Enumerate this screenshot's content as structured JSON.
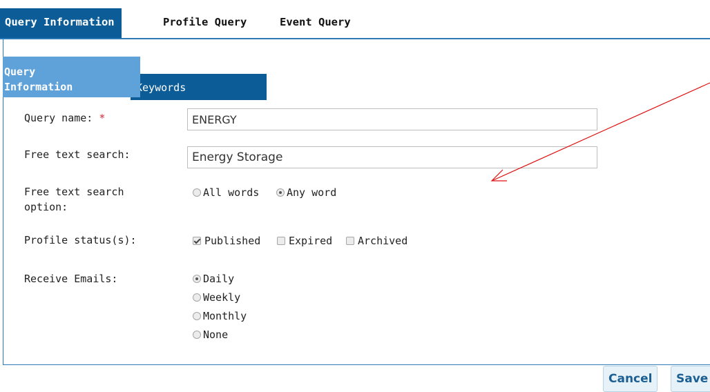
{
  "top_tabs": [
    {
      "label": "Query Information",
      "active": true
    },
    {
      "label": "Profile Query",
      "active": false
    },
    {
      "label": "Event Query",
      "active": false
    }
  ],
  "sub_tabs": [
    {
      "label": "Query Information",
      "active": true
    },
    {
      "label": "Keywords",
      "active": false
    }
  ],
  "form": {
    "query_name": {
      "label": "Query name:",
      "required_mark": "*",
      "value": "ENERGY"
    },
    "free_text": {
      "label": "Free text search:",
      "value": "Energy Storage"
    },
    "free_text_option": {
      "label": "Free text search option:",
      "options": [
        {
          "label": "All words",
          "selected": false
        },
        {
          "label": "Any word",
          "selected": true
        }
      ]
    },
    "profile_status": {
      "label": "Profile status(s):",
      "options": [
        {
          "label": "Published",
          "checked": true
        },
        {
          "label": "Expired",
          "checked": false
        },
        {
          "label": "Archived",
          "checked": false
        }
      ]
    },
    "receive_emails": {
      "label": "Receive Emails:",
      "options": [
        {
          "label": "Daily",
          "selected": true
        },
        {
          "label": "Weekly",
          "selected": false
        },
        {
          "label": "Monthly",
          "selected": false
        },
        {
          "label": "None",
          "selected": false
        }
      ]
    }
  },
  "buttons": {
    "cancel": "Cancel",
    "save": "Save"
  },
  "colors": {
    "tab_active": "#0b5c97",
    "subtab_active": "#5fa1d9",
    "border": "#2b79b6",
    "required": "#d9232e",
    "annotation_arrow": "#e01010"
  }
}
